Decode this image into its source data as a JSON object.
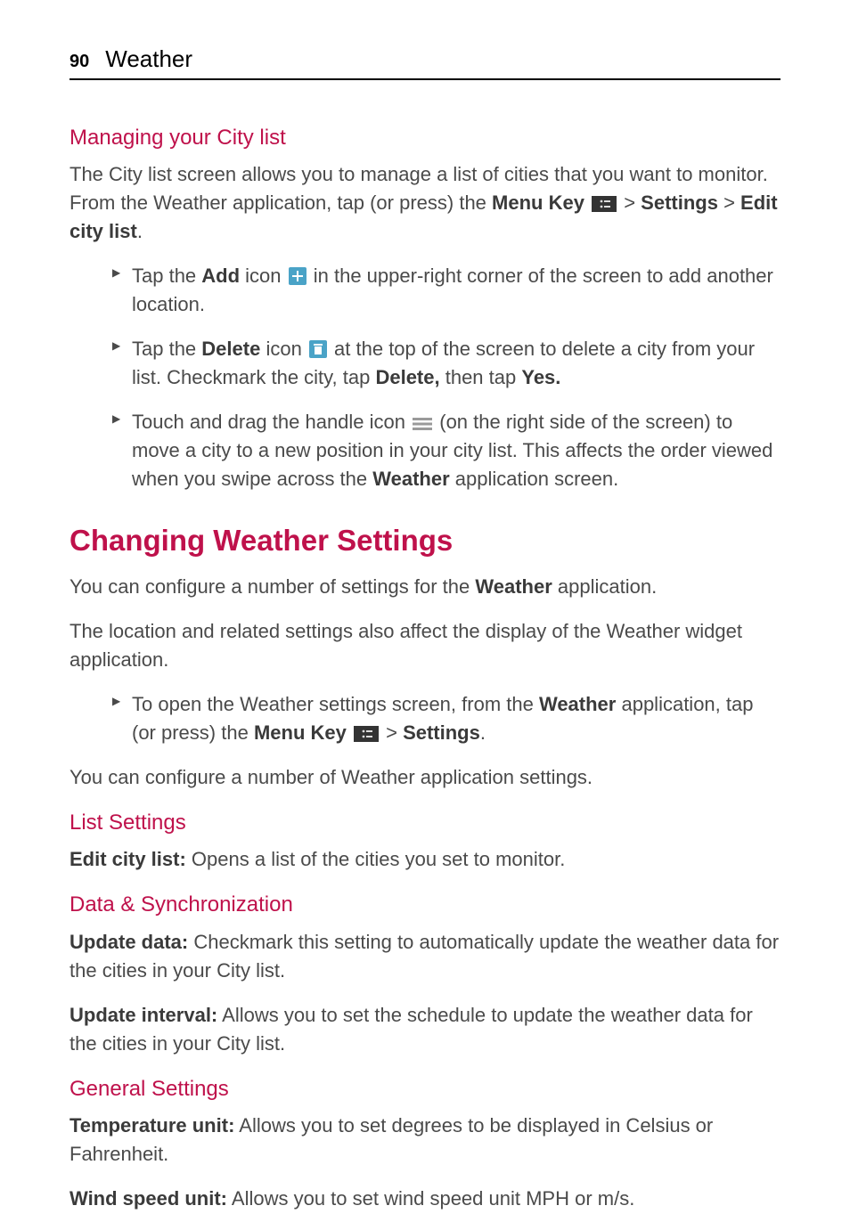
{
  "header": {
    "page_number": "90",
    "section": "Weather"
  },
  "h_managing": "Managing your City list",
  "p_citylist_1a": "The City list screen allows you to manage a list of cities that you want to monitor. From the Weather application, tap (or press) the ",
  "p_citylist_1b": "Menu Key",
  "p_citylist_1c": " > ",
  "p_citylist_1d": "Settings",
  "p_citylist_1e": " > ",
  "p_citylist_1f": "Edit city list",
  "p_citylist_1g": ".",
  "li_add_a": "Tap the ",
  "li_add_b": "Add",
  "li_add_c": " icon ",
  "li_add_d": " in the upper-right corner of the screen to add another location.",
  "li_del_a": "Tap the ",
  "li_del_b": "Delete",
  "li_del_c": " icon ",
  "li_del_d": " at the top of the screen to delete a city from your list. Checkmark the city, tap ",
  "li_del_e": "Delete,",
  "li_del_f": " then tap ",
  "li_del_g": "Yes.",
  "li_drag_a": "Touch and drag the handle icon ",
  "li_drag_b": " (on the right side of the screen) to move a city to a new position in your city list. This affects the order viewed when you swipe across the ",
  "li_drag_c": "Weather",
  "li_drag_d": " application screen.",
  "h_changing": "Changing Weather Settings",
  "p_conf_a": "You can configure a number of settings for the ",
  "p_conf_b": "Weather",
  "p_conf_c": " application.",
  "p_loc": "The location and related settings also affect the display of the Weather widget application.",
  "li_open_a": "To open the Weather settings screen, from the ",
  "li_open_b": "Weather",
  "li_open_c": " application, tap (or press) the ",
  "li_open_d": "Menu Key",
  "li_open_e": " > ",
  "li_open_f": "Settings",
  "li_open_g": ".",
  "p_conf2": "You can configure a number of Weather application settings.",
  "h_list": "List Settings",
  "p_edit_a": "Edit city list:",
  "p_edit_b": " Opens a list of the cities you set to monitor.",
  "h_data": "Data & Synchronization",
  "p_upd_a": "Update data:",
  "p_upd_b": " Checkmark this setting to automatically update the weather data for the cities in your City list.",
  "p_int_a": "Update interval:",
  "p_int_b": " Allows you to set the schedule to update the weather data for the cities in your City list.",
  "h_gen": "General Settings",
  "p_temp_a": "Temperature unit:",
  "p_temp_b": " Allows you to set degrees to be displayed in Celsius or Fahrenheit.",
  "p_wind_a": "Wind speed unit:",
  "p_wind_b": " Allows you to set wind speed unit MPH or m/s."
}
